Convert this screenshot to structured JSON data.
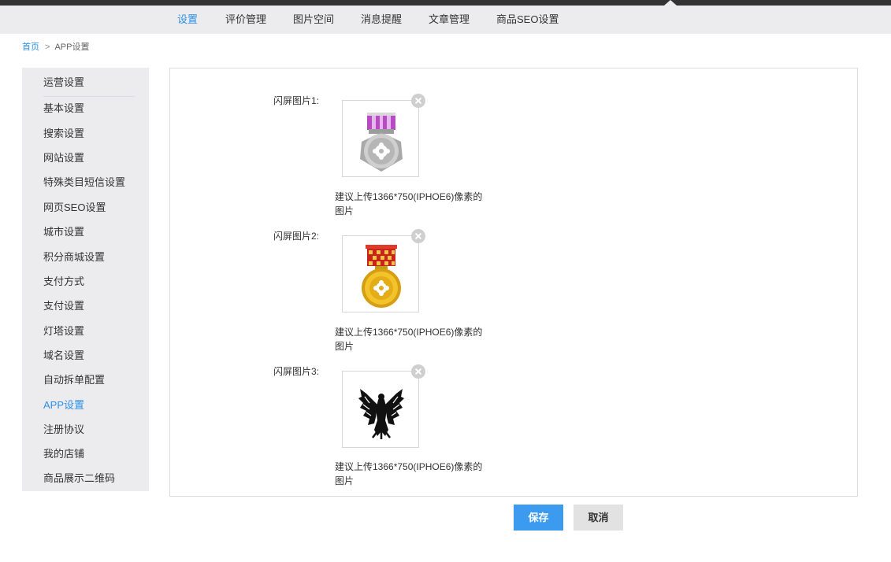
{
  "nav": {
    "tabs": [
      {
        "label": "设置",
        "active": true
      },
      {
        "label": "评价管理"
      },
      {
        "label": "图片空间"
      },
      {
        "label": "消息提醒"
      },
      {
        "label": "文章管理"
      },
      {
        "label": "商品SEO设置"
      }
    ]
  },
  "breadcrumb": {
    "home": "首页",
    "separator": ">",
    "current": "APP设置"
  },
  "sidebar": {
    "items": [
      {
        "label": "运营设置"
      },
      {
        "label": "基本设置"
      },
      {
        "label": "搜索设置"
      },
      {
        "label": "网站设置"
      },
      {
        "label": "特殊类目短信设置"
      },
      {
        "label": "网页SEO设置"
      },
      {
        "label": "城市设置"
      },
      {
        "label": "积分商城设置"
      },
      {
        "label": "支付方式"
      },
      {
        "label": "支付设置"
      },
      {
        "label": "灯塔设置"
      },
      {
        "label": "域名设置"
      },
      {
        "label": "自动拆单配置"
      },
      {
        "label": "APP设置",
        "active": true
      },
      {
        "label": "注册协议"
      },
      {
        "label": "我的店铺"
      },
      {
        "label": "商品展示二维码"
      }
    ]
  },
  "splash": {
    "items": [
      {
        "label": "闪屏图片1:",
        "hint_line1": "建议上传1366*750(IPHOE6)像素的",
        "hint_line2": "图片",
        "image": "silver-medal-icon"
      },
      {
        "label": "闪屏图片2:",
        "hint_line1": "建议上传1366*750(IPHOE6)像素的",
        "hint_line2": "图片",
        "image": "gold-medal-icon"
      },
      {
        "label": "闪屏图片3:",
        "hint_line1": "建议上传1366*750(IPHOE6)像素的",
        "hint_line2": "图片",
        "image": "eagle-emblem-icon"
      }
    ]
  },
  "actions": {
    "save": "保存",
    "cancel": "取消"
  },
  "colors": {
    "accent": "#2d8fe6",
    "save_button": "#3d9bef",
    "nav_background": "#ececef",
    "top_bar": "#333333"
  }
}
